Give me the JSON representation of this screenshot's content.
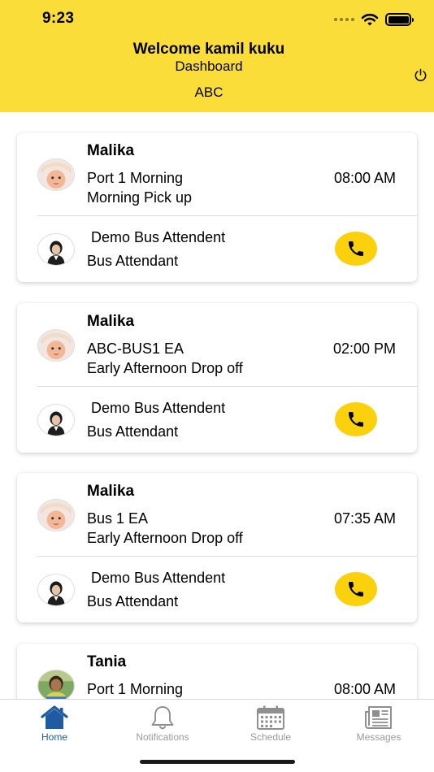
{
  "status_bar": {
    "time": "9:23"
  },
  "header": {
    "welcome": "Welcome kamil kuku",
    "subtitle": "Dashboard",
    "school": "ABC",
    "power_icon": "power-icon"
  },
  "trips": [
    {
      "student_name": "Malika",
      "route": "Port 1 Morning",
      "time": "08:00 AM",
      "trip": "Morning Pick up",
      "attendant_name": " Demo Bus Attendent",
      "attendant_role": "Bus Attendant"
    },
    {
      "student_name": "Malika",
      "route": "ABC-BUS1 EA",
      "time": "02:00 PM",
      "trip": "Early Afternoon Drop off",
      "attendant_name": " Demo Bus Attendent",
      "attendant_role": "Bus Attendant"
    },
    {
      "student_name": "Malika",
      "route": "Bus 1 EA",
      "time": "07:35 AM",
      "trip": "Early Afternoon Drop off",
      "attendant_name": " Demo Bus Attendent",
      "attendant_role": "Bus Attendant"
    },
    {
      "student_name": "Tania",
      "route": "Port 1 Morning",
      "time": "08:00 AM"
    }
  ],
  "tabbar": {
    "items": [
      {
        "label": "Home",
        "icon": "home-icon",
        "active": true
      },
      {
        "label": "Notifications",
        "icon": "bell-icon",
        "active": false
      },
      {
        "label": "Schedule",
        "icon": "calendar-icon",
        "active": false
      },
      {
        "label": "Messages",
        "icon": "newspaper-icon",
        "active": false
      }
    ]
  },
  "colors": {
    "header_bg": "#fbdd3a",
    "call_button": "#fbd00d",
    "active_tab": "#1f5ba0",
    "inactive_tab": "#9a9a9a"
  }
}
